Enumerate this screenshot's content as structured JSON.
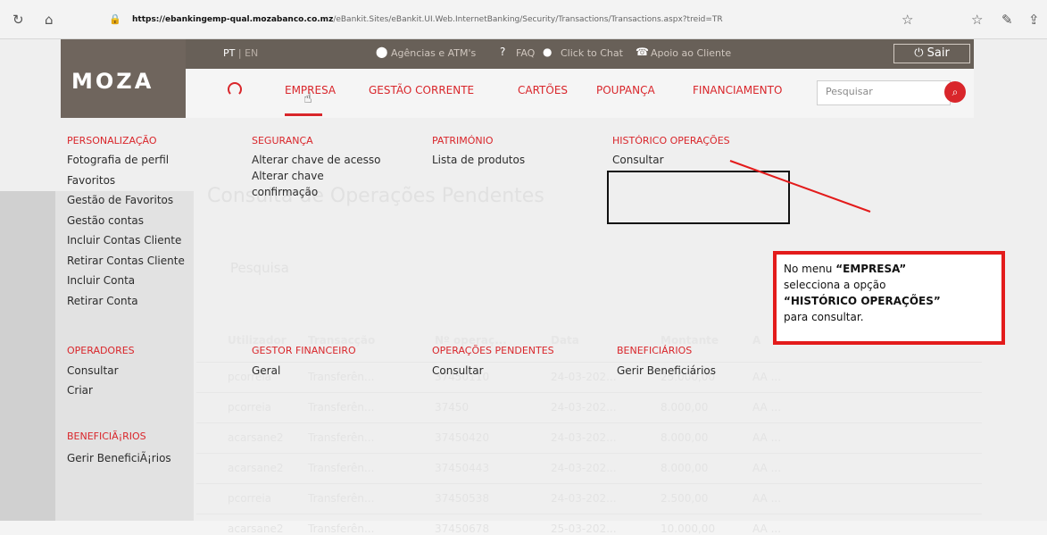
{
  "browser": {
    "url_host": "https://ebankingemp-qual.mozabanco.co.mz",
    "url_rest": "/eBankit.Sites/eBankit.UI.Web.InternetBanking/Security/Transactions/Transactions.aspx?treid=TR"
  },
  "brand": {
    "logo": "MOZA"
  },
  "topbar": {
    "lang_active": "PT",
    "lang_sep": " | ",
    "lang_other": "EN",
    "agencias": "Agências e ATM's",
    "faq": "FAQ",
    "chat": "Click to Chat",
    "apoio": "Apoio ao Cliente",
    "sair": "Sair"
  },
  "nav": {
    "items": [
      "EMPRESA",
      "GESTÃO CORRENTE",
      "CARTÕES",
      "POUPANÇA",
      "FINANCIAMENTO"
    ],
    "search_placeholder": "Pesquisar"
  },
  "background_page": {
    "title": "Consulta de Operações Pendentes",
    "tab": "Pesquisa",
    "columns": [
      "Utilizador",
      "Transacção",
      "Nº operaç...",
      "Data",
      "Montante",
      "A"
    ],
    "rows": [
      [
        "pcorreia",
        "Transferên...",
        "37450110",
        "24-03-202...",
        "25.000,00",
        "AA ..."
      ],
      [
        "pcorreia",
        "Transferên...",
        "37450",
        "24-03-202...",
        "8.000,00",
        "AA ..."
      ],
      [
        "acarsane2",
        "Transferên...",
        "37450420",
        "24-03-202...",
        "8.000,00",
        "AA ..."
      ],
      [
        "acarsane2",
        "Transferên...",
        "37450443",
        "24-03-202...",
        "8.000,00",
        "AA ..."
      ],
      [
        "pcorreia",
        "Transferên...",
        "37450538",
        "24-03-202...",
        "2.500,00",
        "AA ..."
      ],
      [
        "acarsane2",
        "Transferên...",
        "37450678",
        "25-03-202...",
        "10.000,00",
        "AA ..."
      ]
    ]
  },
  "menu": {
    "personalizacao": {
      "head": "PERSONALIZAÇÃO",
      "items": [
        "Fotografia de perfil",
        "Favoritos",
        "Gestão de Favoritos",
        "Gestão contas",
        "Incluir Contas Cliente",
        "Retirar Contas Cliente",
        "Incluir Conta",
        "Retirar Conta"
      ]
    },
    "seguranca": {
      "head": "SEGURANÇA",
      "items": [
        "Alterar chave de acesso",
        "Alterar chave",
        "confirmação"
      ]
    },
    "patrimonio": {
      "head": "PATRIMÓNIO",
      "items": [
        "Lista de produtos"
      ]
    },
    "historico": {
      "head": "HISTÓRICO OPERAÇÕES",
      "items": [
        "Consultar"
      ]
    },
    "operadores": {
      "head": "OPERADORES",
      "items": [
        "Consultar",
        "Criar"
      ]
    },
    "gestor": {
      "head": "GESTOR FINANCEIRO",
      "items": [
        "Geral"
      ]
    },
    "pendentes": {
      "head": "OPERAÇÕES PENDENTES",
      "items": [
        "Consultar"
      ]
    },
    "beneficiarios": {
      "head": "BENEFICIÁRIOS",
      "items": [
        "Gerir Beneficiários"
      ]
    },
    "beneficiarios2": {
      "head": "BENEFICIÃ¡RIOS",
      "items": [
        "Gerir BeneficiÃ¡rios"
      ]
    }
  },
  "callout": {
    "l1_pre": "No menu ",
    "l1_bold": "“EMPRESA”",
    "l2": "selecciona a opção",
    "l3_bold": "“HISTÓRICO OPERAÇÕES”",
    "l4": "para consultar."
  },
  "colors": {
    "brand_red": "#d9262b",
    "brand_brown": "#6f655d"
  }
}
